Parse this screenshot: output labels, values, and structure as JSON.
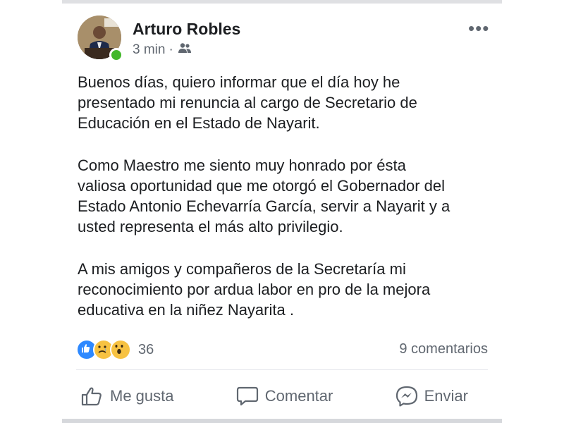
{
  "post": {
    "author": "Arturo Robles",
    "time": "3 min",
    "separator": "·",
    "audience_icon": "friends-icon",
    "more_icon": "more-options-icon",
    "more_label": "•••",
    "paragraphs": [
      "Buenos días, quiero informar que el día hoy he\npresentado mi renuncia al cargo de Secretario de\nEducación en el Estado de Nayarit.",
      "Como Maestro me siento muy honrado por ésta\nvaliosa oportunidad que me otorgó el Gobernador del\nEstado Antonio Echevarría García, servir a Nayarit y a\nusted representa el más alto privilegio.",
      "A mis amigos y compañeros de la Secretaría mi\nreconocimiento por ardua labor en pro de la mejora\neducativa en la niñez Nayarita ."
    ]
  },
  "stats": {
    "reactions": [
      "like-reaction",
      "sad-reaction",
      "wow-reaction"
    ],
    "reaction_count": "36",
    "comments": "9 comentarios"
  },
  "actions": {
    "like": "Me gusta",
    "comment": "Comentar",
    "send": "Enviar"
  },
  "colors": {
    "text": "#1c1e21",
    "secondary": "#606770",
    "like_blue": "#2e89ff",
    "emoji_yellow": "#f7c242",
    "online_green": "#42b72a"
  }
}
